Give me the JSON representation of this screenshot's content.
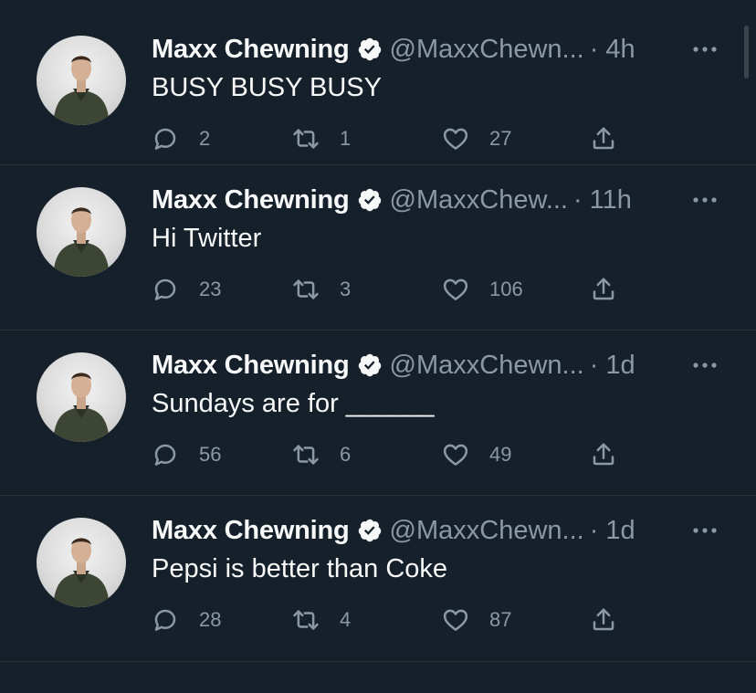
{
  "tweets": [
    {
      "name": "Maxx Chewning",
      "handle": "@MaxxChewn...",
      "time": "4h",
      "separator": "·",
      "text": "BUSY BUSY BUSY",
      "replies": "2",
      "retweets": "1",
      "likes": "27"
    },
    {
      "name": "Maxx Chewning",
      "handle": "@MaxxChew...",
      "time": "11h",
      "separator": "·",
      "text": "Hi Twitter",
      "replies": "23",
      "retweets": "3",
      "likes": "106"
    },
    {
      "name": "Maxx Chewning",
      "handle": "@MaxxChewn...",
      "time": "1d",
      "separator": "·",
      "text": "Sundays are for ______",
      "replies": "56",
      "retweets": "6",
      "likes": "49"
    },
    {
      "name": "Maxx Chewning",
      "handle": "@MaxxChewn...",
      "time": "1d",
      "separator": "·",
      "text": "Pepsi is better than Coke",
      "replies": "28",
      "retweets": "4",
      "likes": "87"
    }
  ],
  "icons": {
    "verified": "verified-badge-icon",
    "more": "more-horizontal-icon",
    "reply": "reply-icon",
    "retweet": "retweet-icon",
    "like": "heart-icon",
    "share": "share-icon"
  },
  "colors": {
    "background": "#15202b",
    "primary_text": "#f7f9f9",
    "secondary_text": "#8b98a5",
    "divider": "#2f3336"
  }
}
